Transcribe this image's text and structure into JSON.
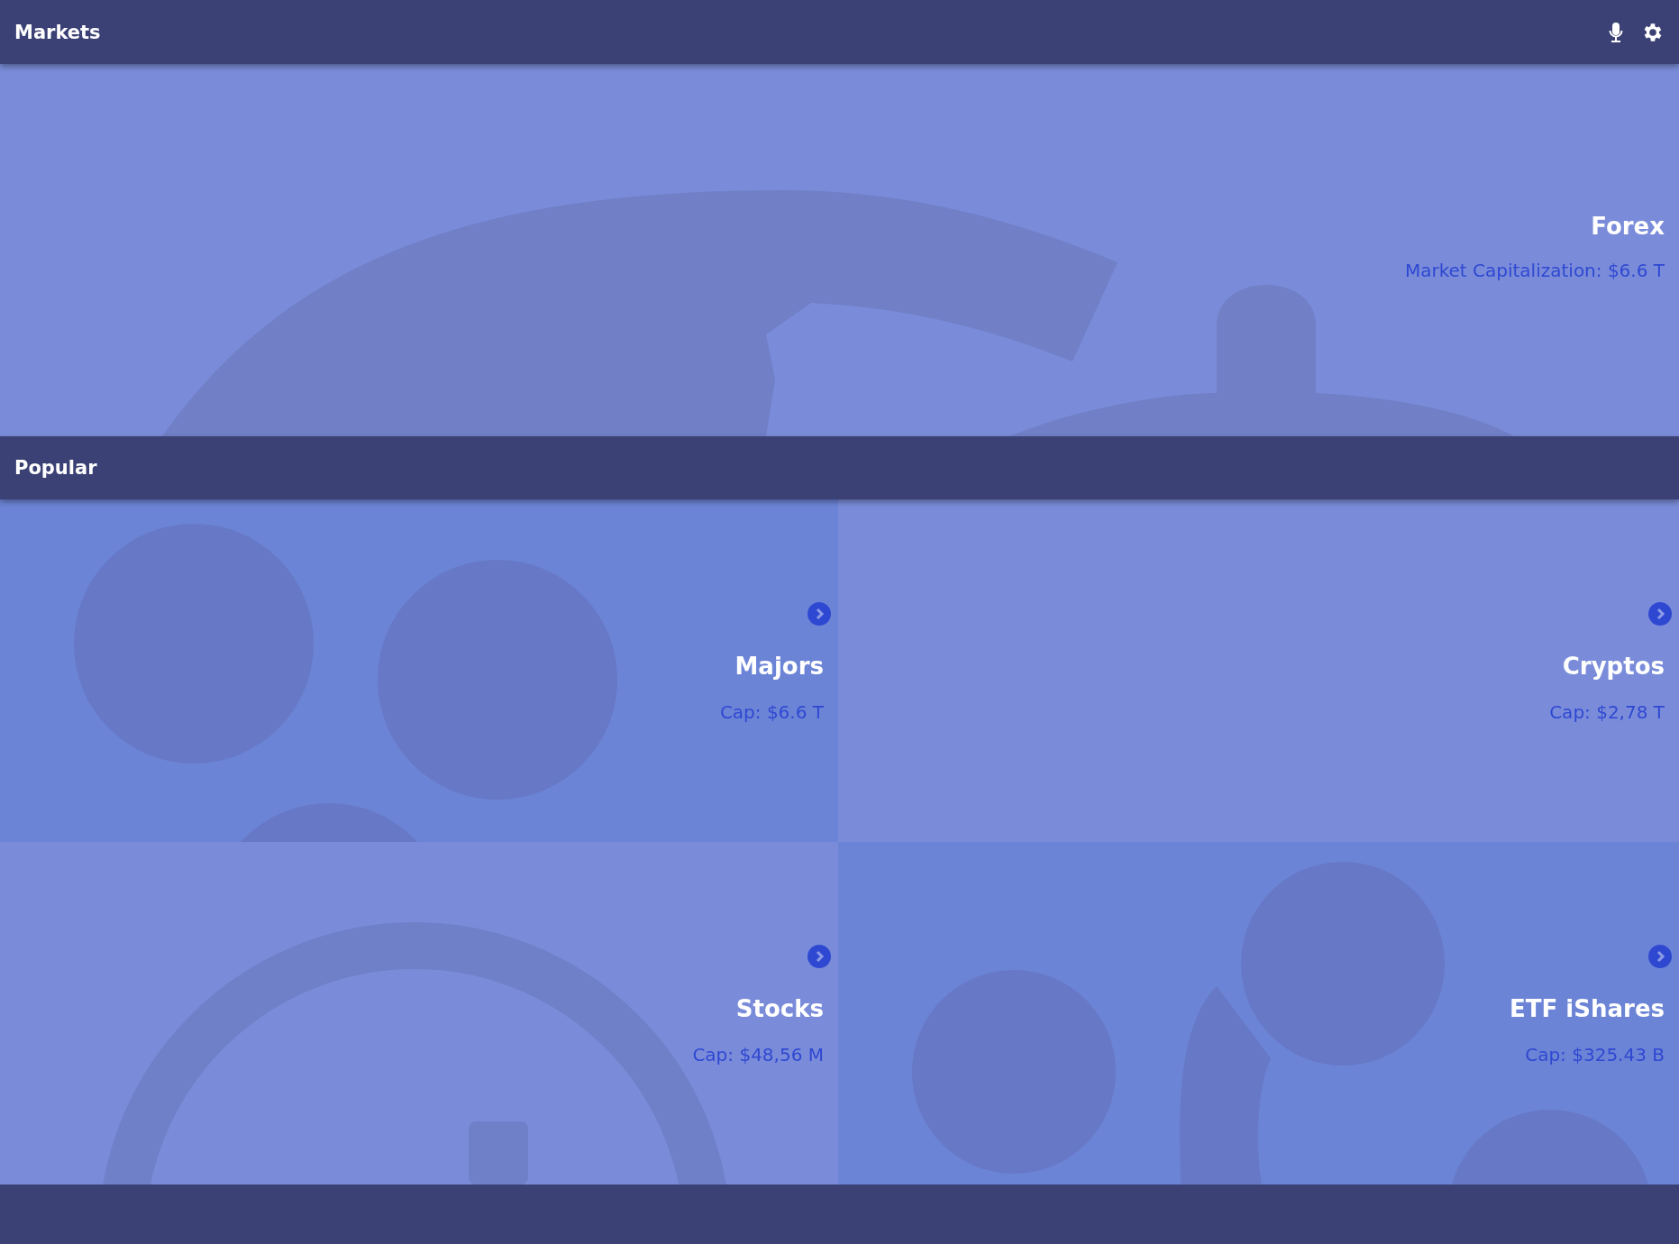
{
  "header": {
    "title": "Markets"
  },
  "hero": {
    "title": "Forex",
    "subtitle": "Market Capitalization: $6.6 T"
  },
  "section": {
    "title": "Popular"
  },
  "tiles": [
    {
      "kind": "coins",
      "title": "Majors",
      "subtitle": "Cap: $6.6 T"
    },
    {
      "kind": "plain",
      "title": "Cryptos",
      "subtitle": "Cap: $2,78 T"
    },
    {
      "kind": "clock",
      "title": "Stocks",
      "subtitle": "Cap: $48,56 M"
    },
    {
      "kind": "dollars",
      "title": "ETF iShares",
      "subtitle": "Cap: $325.43 B"
    }
  ]
}
